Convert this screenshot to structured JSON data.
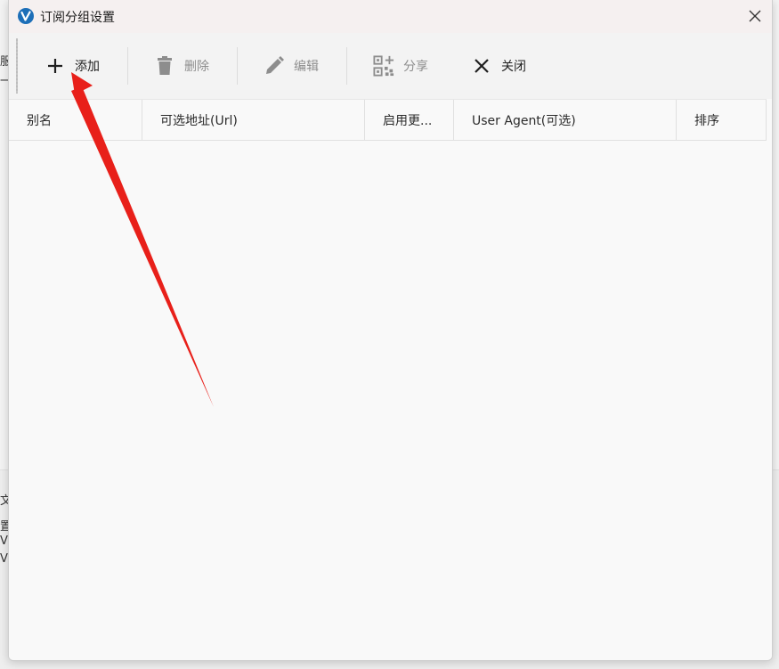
{
  "window": {
    "title": "订阅分组设置"
  },
  "toolbar": {
    "buttons": [
      {
        "label": "添加",
        "icon": "plus-icon"
      },
      {
        "label": "删除",
        "icon": "trash-icon"
      },
      {
        "label": "编辑",
        "icon": "pencil-icon"
      },
      {
        "label": "分享",
        "icon": "qr-code-icon"
      },
      {
        "label": "关闭",
        "icon": "close-icon"
      }
    ]
  },
  "table": {
    "columns": [
      "别名",
      "可选地址(Url)",
      "启用更...",
      "User Agent(可选)",
      "排序"
    ],
    "rows": []
  },
  "background_fragments": [
    "服",
    "一",
    "文",
    "置",
    "V:",
    "V:"
  ],
  "colors": {
    "annotation_arrow": "#e8201a",
    "app_icon": "#1d6fb8"
  }
}
